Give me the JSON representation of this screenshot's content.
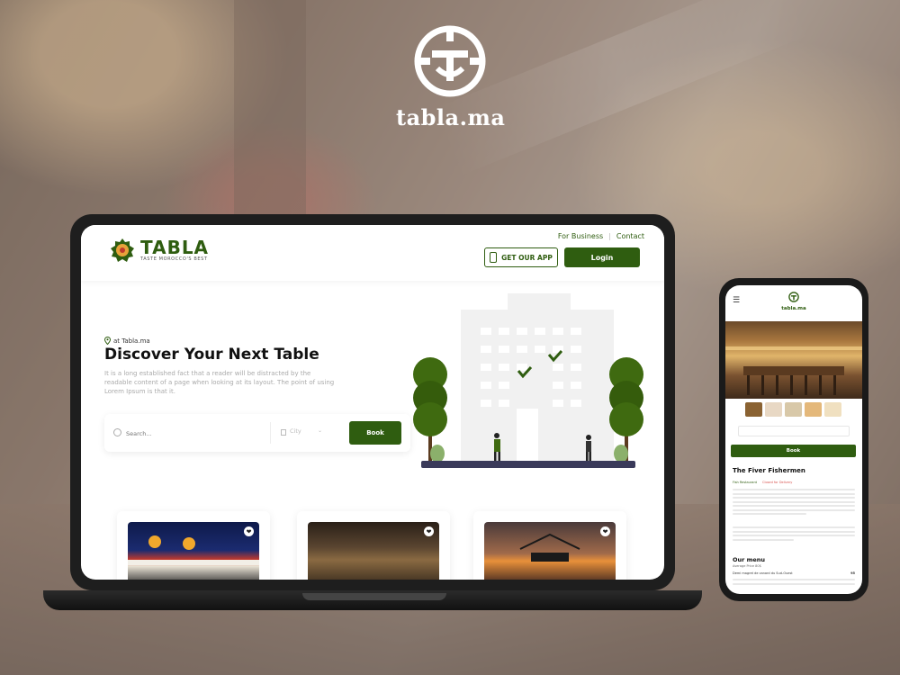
{
  "brand": {
    "name": "tabla.ma"
  },
  "laptop": {
    "header": {
      "logo_title": "TABLA",
      "logo_tagline": "TASTE MOROCCO'S BEST",
      "links": [
        "For Business",
        "Contact"
      ],
      "get_app_label": "GET OUR APP",
      "login_label": "Login"
    },
    "hero": {
      "location": "at Tabla.ma",
      "title": "Discover Your Next Table",
      "description": "It is a long established fact that a reader will be distracted by the readable content of a page when looking at its layout. The point of using Lorem Ipsum is that it.",
      "search_placeholder": "Search...",
      "city_placeholder": "City",
      "book_label": "Book"
    }
  },
  "phone": {
    "header": {
      "logo_name": "tabla.ma"
    },
    "book_label": "Book",
    "restaurant_name": "The Fiver Fishermen",
    "tags": [
      "Fish Restaurant",
      "Closed for Delivery"
    ],
    "menu_title": "Our menu",
    "price_label": "Average Price 80$",
    "menu_items": [
      {
        "name": "Demi magret de canard du Sud-Ouest",
        "price": "95"
      }
    ]
  },
  "colors": {
    "brand_green": "#2f5d10",
    "accent_red": "#d9534f"
  },
  "icons": [
    "menu-icon",
    "heart-icon",
    "search-icon",
    "location-pin-icon",
    "phone-icon",
    "chevron-down-icon"
  ]
}
